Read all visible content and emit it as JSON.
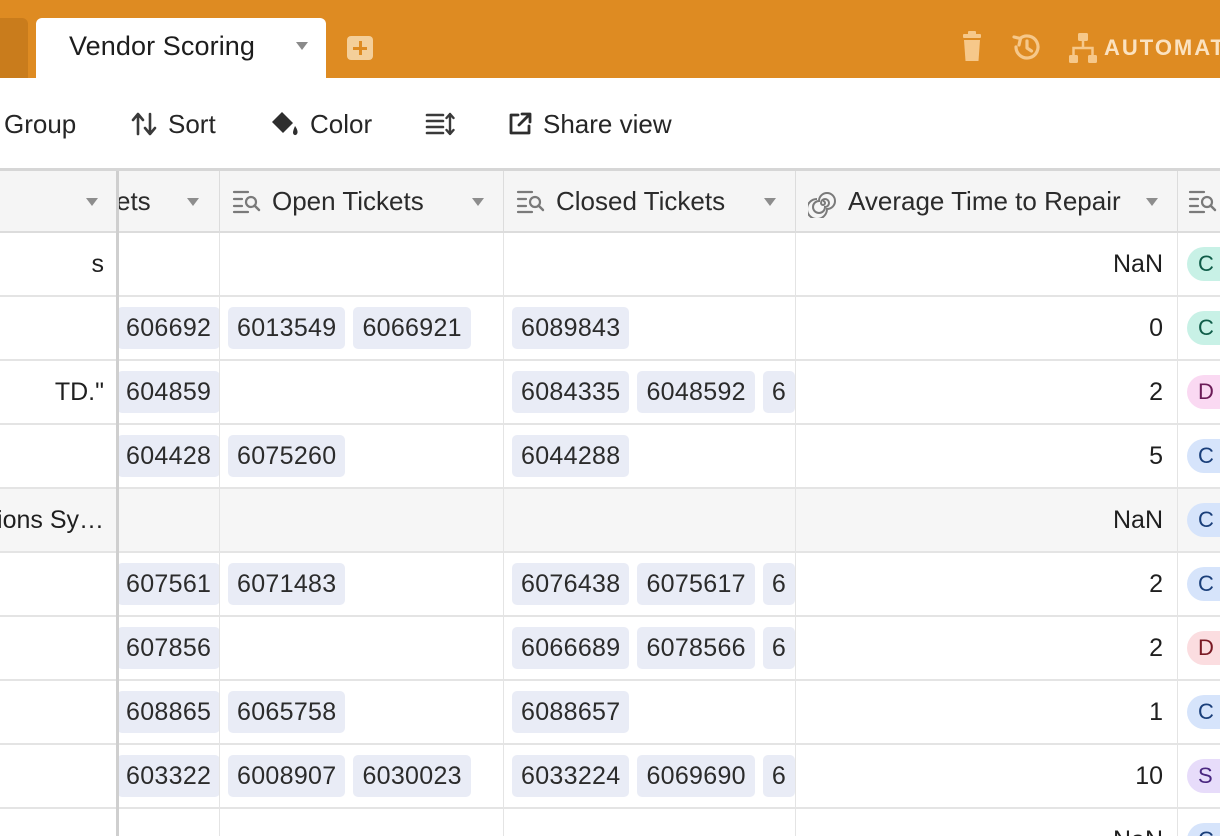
{
  "topbar": {
    "tab_title": "Vendor Scoring",
    "automations_label": "AUTOMAT",
    "icons": [
      "trash-icon",
      "history-icon",
      "automations-icon",
      "add-table-icon"
    ]
  },
  "toolbar": {
    "group_label": "Group",
    "sort_label": "Sort",
    "color_label": "Color",
    "share_label": "Share view"
  },
  "columns": {
    "tickets_partial": "ets",
    "open_tickets": "Open Tickets",
    "closed_tickets": "Closed Tickets",
    "avg_time_to_repair": "Average Time to Repair"
  },
  "rows": [
    {
      "name": "s",
      "tickets": [],
      "open": [],
      "closed": [],
      "avg": "NaN",
      "status": "C",
      "status_color": "#c8f1e6",
      "status_text": "#0f5c48",
      "alt": false
    },
    {
      "name": "",
      "tickets": [
        "606692"
      ],
      "open": [
        "6013549",
        "6066921"
      ],
      "closed": [
        "6089843"
      ],
      "avg": "0",
      "status": "C",
      "status_color": "#c8f1e6",
      "status_text": "#0f5c48",
      "alt": false
    },
    {
      "name": "TD.\"",
      "tickets": [
        "604859"
      ],
      "open": [],
      "closed": [
        "6084335",
        "6048592",
        "6"
      ],
      "avg": "2",
      "status": "D",
      "status_color": "#fad9f2",
      "status_text": "#6b1b57",
      "alt": false
    },
    {
      "name": "",
      "tickets": [
        "604428"
      ],
      "open": [
        "6075260"
      ],
      "closed": [
        "6044288"
      ],
      "avg": "5",
      "status": "C",
      "status_color": "#d6e4fb",
      "status_text": "#1a3f7a",
      "alt": false
    },
    {
      "name": "ions Sy…",
      "tickets": [],
      "open": [],
      "closed": [],
      "avg": "NaN",
      "status": "C",
      "status_color": "#d6e4fb",
      "status_text": "#1a3f7a",
      "alt": true
    },
    {
      "name": "",
      "tickets": [
        "607561"
      ],
      "open": [
        "6071483"
      ],
      "closed": [
        "6076438",
        "6075617",
        "6"
      ],
      "avg": "2",
      "status": "C",
      "status_color": "#d6e4fb",
      "status_text": "#1a3f7a",
      "alt": false
    },
    {
      "name": "",
      "tickets": [
        "607856"
      ],
      "open": [],
      "closed": [
        "6066689",
        "6078566",
        "6"
      ],
      "avg": "2",
      "status": "D",
      "status_color": "#fbdde0",
      "status_text": "#7a1a24",
      "alt": false
    },
    {
      "name": "",
      "tickets": [
        "608865"
      ],
      "open": [
        "6065758"
      ],
      "closed": [
        "6088657"
      ],
      "avg": "1",
      "status": "C",
      "status_color": "#d6e4fb",
      "status_text": "#1a3f7a",
      "alt": false
    },
    {
      "name": "",
      "tickets": [
        "603322"
      ],
      "open": [
        "6008907",
        "6030023"
      ],
      "closed": [
        "6033224",
        "6069690",
        "6"
      ],
      "avg": "10",
      "status": "S",
      "status_color": "#e7dcfa",
      "status_text": "#4a2780",
      "alt": false
    },
    {
      "name": "",
      "tickets": [],
      "open": [],
      "closed": [],
      "avg": "NaN",
      "status": "C",
      "status_color": "#d6e4fb",
      "status_text": "#1a3f7a",
      "alt": false
    }
  ],
  "colors": {
    "topbar": "#de8b22",
    "chip": "#e9ecf6"
  }
}
